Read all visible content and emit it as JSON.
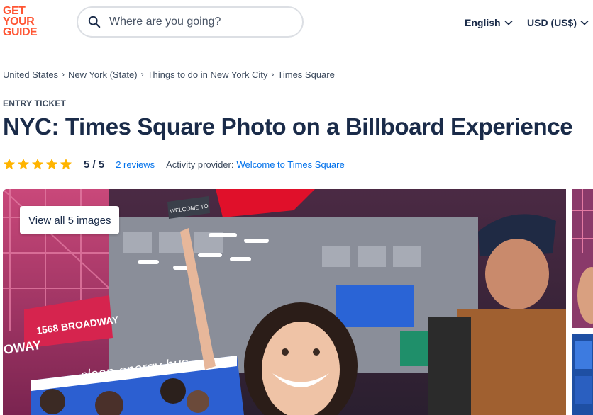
{
  "brand": {
    "logo_lines": [
      "GET",
      "YOUR",
      "GUIDE"
    ],
    "color": "#ff5533"
  },
  "search": {
    "placeholder": "Where are you going?",
    "icon": "search-icon"
  },
  "header": {
    "language": "English",
    "currency": "USD (US$)"
  },
  "breadcrumb": [
    "United States",
    "New York (State)",
    "Things to do in New York City",
    "Times Square"
  ],
  "activity": {
    "category": "ENTRY TICKET",
    "title": "NYC: Times Square Photo on a Billboard Experience",
    "rating": "5 / 5",
    "rating_value": 5,
    "star_count": 5,
    "reviews_link": "2 reviews",
    "provider_label": "Activity provider:",
    "provider_name": "Welcome to Times Square"
  },
  "gallery": {
    "view_all_label": "View all 5 images",
    "billboard_text_1": "1568 BROADWAY",
    "billboard_text_2": "OWAY",
    "bus_text": "clean-energy bus",
    "sign_text": "WELCOME TO"
  },
  "colors": {
    "text_dark": "#1a2b49",
    "link": "#0071eb",
    "star": "#ffb400"
  }
}
